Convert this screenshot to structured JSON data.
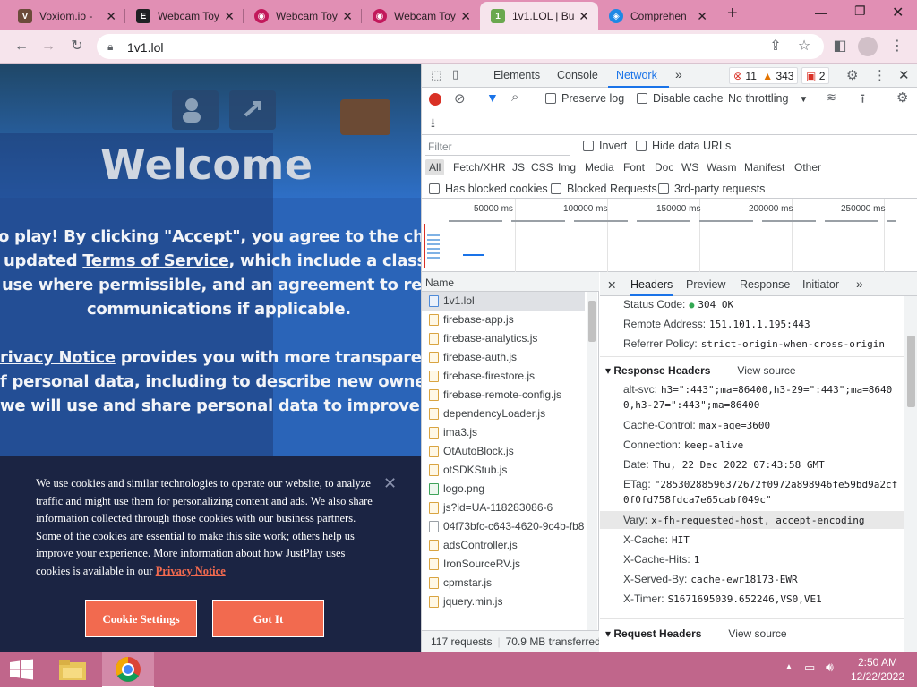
{
  "tabs": [
    {
      "title": "Voxiom.io -",
      "icon": "voxiom-favicon",
      "color": "#6b4b3a"
    },
    {
      "title": "Webcam Toy",
      "icon": "webcamtoy-favicon",
      "color": "#202124"
    },
    {
      "title": "Webcam Toy",
      "icon": "webcamtoy-favicon",
      "color": "#c2185b"
    },
    {
      "title": "Webcam Toy",
      "icon": "webcamtoy-favicon",
      "color": "#c2185b"
    },
    {
      "title": "1v1.LOL | Bu",
      "icon": "1v1lol-favicon",
      "color": "#6aa84f"
    },
    {
      "title": "Comprehen",
      "icon": "shield-favicon",
      "color": "#1e88e5"
    }
  ],
  "omnibox": {
    "url": "1v1.lol"
  },
  "page": {
    "welcome": "Welcome",
    "lines": [
      "o play! By clicking \"Accept\", you agree to the change",
      "updated ",
      "Terms of Service",
      ", which include a class act",
      "use where permissible, and an agreement to receiv",
      "communications if applicable.",
      "rivacy Notice",
      " provides you with more transparency",
      "f personal data, including to describe new owners",
      "we will use and share personal data to improve th"
    ],
    "cookie_text": "We use cookies and similar technologies to operate our website, to analyze traffic and might use them for personalizing content and ads. We also share information collected through those cookies with our business partners. Some of the cookies are essential to make this site work; others help us improve your experience. More information about how JustPlay uses cookies is available in our",
    "cookie_link": "Privacy Notice",
    "cookie_settings": "Cookie Settings",
    "got_it": "Got It"
  },
  "devtools": {
    "tabs": [
      "Elements",
      "Console",
      "Network"
    ],
    "more": "»",
    "counts": {
      "errors": "11",
      "warnings": "343",
      "issues": "2"
    },
    "toolbar": {
      "preserve_log": "Preserve log",
      "disable_cache": "Disable cache",
      "throttling": "No throttling"
    },
    "filter": {
      "placeholder": "Filter",
      "invert": "Invert",
      "hide_data_urls": "Hide data URLs"
    },
    "types": [
      "All",
      "Fetch/XHR",
      "JS",
      "CSS",
      "Img",
      "Media",
      "Font",
      "Doc",
      "WS",
      "Wasm",
      "Manifest",
      "Other"
    ],
    "blocked": {
      "has_blocked_cookies": "Has blocked cookies",
      "blocked_requests": "Blocked Requests",
      "third_party": "3rd-party requests"
    },
    "ticks": [
      "50000 ms",
      "100000 ms",
      "150000 ms",
      "200000 ms",
      "250000 ms"
    ],
    "name_header": "Name",
    "requests": [
      {
        "name": "1v1.lol",
        "type": "doc"
      },
      {
        "name": "firebase-app.js",
        "type": "js"
      },
      {
        "name": "firebase-analytics.js",
        "type": "js"
      },
      {
        "name": "firebase-auth.js",
        "type": "js"
      },
      {
        "name": "firebase-firestore.js",
        "type": "js"
      },
      {
        "name": "firebase-remote-config.js",
        "type": "js"
      },
      {
        "name": "dependencyLoader.js",
        "type": "js"
      },
      {
        "name": "ima3.js",
        "type": "js"
      },
      {
        "name": "OtAutoBlock.js",
        "type": "js"
      },
      {
        "name": "otSDKStub.js",
        "type": "js"
      },
      {
        "name": "logo.png",
        "type": "img"
      },
      {
        "name": "js?id=UA-118283086-6",
        "type": "js"
      },
      {
        "name": "04f73bfc-c643-4620-9c4b-fb8",
        "type": "blank"
      },
      {
        "name": "adsController.js",
        "type": "js"
      },
      {
        "name": "IronSourceRV.js",
        "type": "js"
      },
      {
        "name": "cpmstar.js",
        "type": "js"
      },
      {
        "name": "jquery.min.js",
        "type": "js"
      }
    ],
    "footer": {
      "requests": "117 requests",
      "transferred": "70.9 MB transferred"
    },
    "detail_tabs": [
      "Headers",
      "Preview",
      "Response",
      "Initiator"
    ],
    "general": [
      {
        "k": "Status Code:",
        "v": "304 OK"
      },
      {
        "k": "Remote Address:",
        "v": "151.101.1.195:443"
      },
      {
        "k": "Referrer Policy:",
        "v": "strict-origin-when-cross-origin"
      }
    ],
    "response_headers_title": "Response Headers",
    "view_source": "View source",
    "response_headers": [
      {
        "k": "alt-svc:",
        "v": "h3=\":443\";ma=86400,h3-29=\":443\";ma=8640",
        "v2": "0,h3-27=\":443\";ma=86400"
      },
      {
        "k": "Cache-Control:",
        "v": "max-age=3600"
      },
      {
        "k": "Connection:",
        "v": "keep-alive"
      },
      {
        "k": "Date:",
        "v": "Thu, 22 Dec 2022 07:43:58 GMT"
      },
      {
        "k": "ETag:",
        "v": "\"28530288596372672f0972a898946fe59bd9a2cf",
        "v2": "0f0fd758fdca7e65cabf049c\""
      },
      {
        "k": "Vary:",
        "v": "x-fh-requested-host, accept-encoding"
      },
      {
        "k": "X-Cache:",
        "v": "HIT"
      },
      {
        "k": "X-Cache-Hits:",
        "v": "1"
      },
      {
        "k": "X-Served-By:",
        "v": "cache-ewr18173-EWR"
      },
      {
        "k": "X-Timer:",
        "v": "S1671695039.652246,VS0,VE1"
      }
    ],
    "request_headers_title": "Request Headers"
  },
  "taskbar": {
    "time": "2:50 AM",
    "date": "12/22/2022"
  }
}
